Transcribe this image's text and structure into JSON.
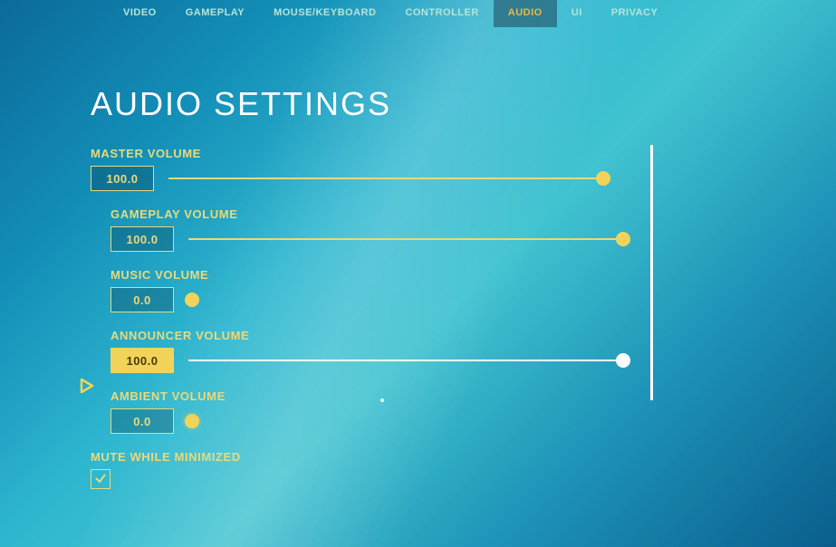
{
  "nav": {
    "items": [
      {
        "label": "VIDEO"
      },
      {
        "label": "GAMEPLAY"
      },
      {
        "label": "MOUSE/KEYBOARD"
      },
      {
        "label": "CONTROLLER"
      },
      {
        "label": "AUDIO"
      },
      {
        "label": "UI"
      },
      {
        "label": "PRIVACY"
      }
    ],
    "active_index": 4
  },
  "page": {
    "title": "AUDIO SETTINGS"
  },
  "settings": {
    "master": {
      "label": "MASTER VOLUME",
      "value": "100.0",
      "percent": 100
    },
    "gameplay": {
      "label": "GAMEPLAY VOLUME",
      "value": "100.0",
      "percent": 100
    },
    "music": {
      "label": "MUSIC VOLUME",
      "value": "0.0",
      "percent": 0
    },
    "announcer": {
      "label": "ANNOUNCER VOLUME",
      "value": "100.0",
      "percent": 100,
      "selected": true
    },
    "ambient": {
      "label": "AMBIENT VOLUME",
      "value": "0.0",
      "percent": 0
    },
    "mute": {
      "label": "MUTE WHILE MINIMIZED",
      "checked": true
    }
  },
  "colors": {
    "accent": "#e9d97a",
    "accent_fill": "#f1d35a",
    "white": "#ffffff"
  }
}
